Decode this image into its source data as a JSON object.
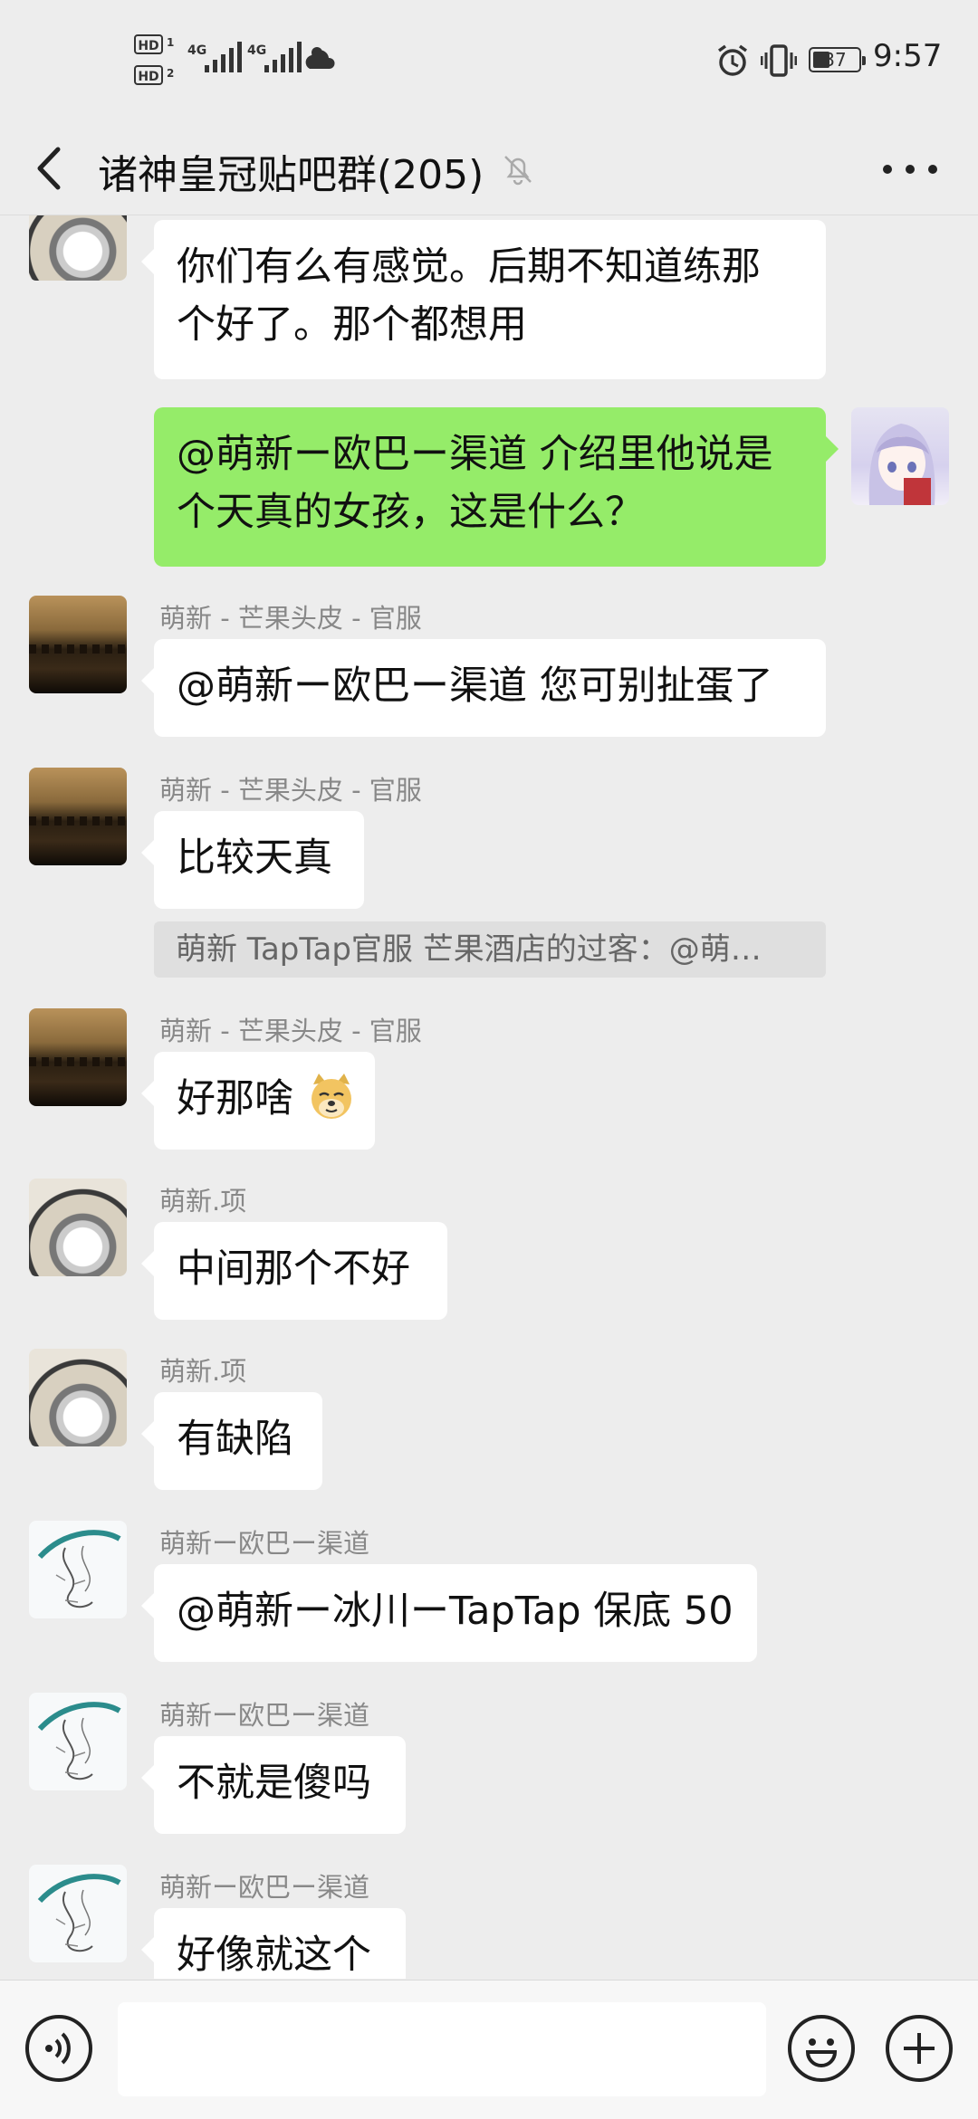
{
  "status_bar": {
    "hd1": "HD",
    "hd1_sub": "1",
    "hd2": "HD",
    "hd2_sub": "2",
    "signal1": "4G",
    "signal2": "4G",
    "battery": "37",
    "time": "9:57"
  },
  "header": {
    "title": "诸神皇冠贴吧群(205)",
    "back_icon": "chevron-left-icon",
    "mute_icon": "bell-off-icon",
    "more_icon": "more-horizontal-icon"
  },
  "messages": [
    {
      "sender": "",
      "text_lines": [
        "你们有么有感觉。后期不知道练那",
        "个好了。那个都想用"
      ]
    },
    {
      "sender": "me",
      "text_lines": [
        "@萌新ー欧巴ー渠道  介绍里他说是",
        "个天真的女孩，这是什么？"
      ]
    },
    {
      "sender": "萌新 - 芒果头皮 - 官服",
      "text": "@萌新ー欧巴ー渠道  您可别扯蛋了"
    },
    {
      "sender": "萌新 - 芒果头皮 - 官服",
      "text": "比较天真"
    },
    {
      "quote": "萌新 TapTap官服 芒果酒店的过客：@萌…"
    },
    {
      "sender": "萌新 - 芒果头皮 - 官服",
      "text": "好那啥",
      "emoji": "doge-emoji-icon"
    },
    {
      "sender": "萌新.项",
      "text": "中间那个不好"
    },
    {
      "sender": "萌新.项",
      "text": "有缺陷"
    },
    {
      "sender": "萌新ー欧巴ー渠道",
      "text": "@萌新ー冰川ーTapTap  保底 50"
    },
    {
      "sender": "萌新ー欧巴ー渠道",
      "text": "不就是傻吗"
    },
    {
      "sender": "萌新ー欧巴ー渠道",
      "text": "好像就这个"
    }
  ],
  "input_bar": {
    "voice_icon": "voice-icon",
    "emoji_icon": "smile-icon",
    "plus_icon": "plus-icon",
    "input_value": ""
  },
  "colors": {
    "background": "#ededed",
    "my_bubble": "#95ec69",
    "other_bubble": "#ffffff",
    "nickname": "#888888"
  }
}
